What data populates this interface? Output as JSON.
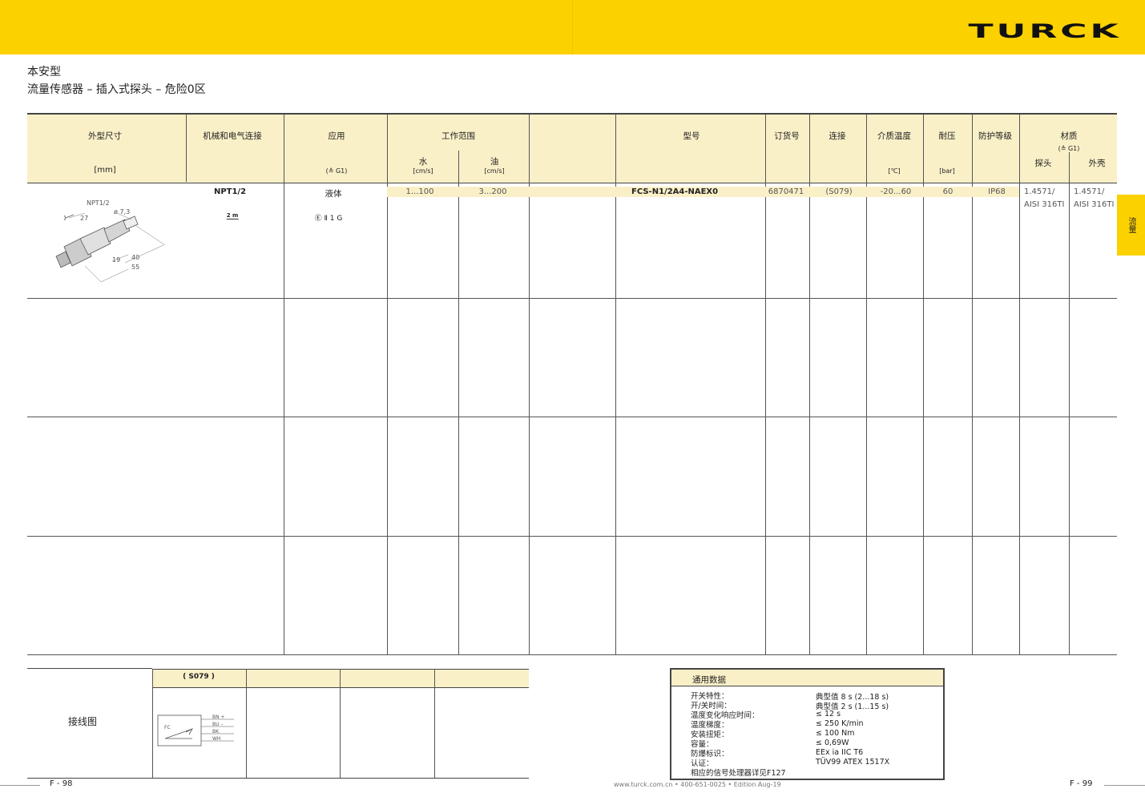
{
  "brand": {
    "logo": "TURCK"
  },
  "page": {
    "title1": "本安型",
    "title2": "流量传感器 – 插入式探头 – 危险0区"
  },
  "side_tab": {
    "label": "流量"
  },
  "table": {
    "headers": {
      "dims": "外型尺寸",
      "dims_unit": "[mm]",
      "conn": "机械和电气连接",
      "app": "应用",
      "app_note": "(≙ G1)",
      "range": "工作范围",
      "water": "水",
      "water_unit": "[cm/s]",
      "oil": "油",
      "oil_unit": "[cm/s]",
      "type": "型号",
      "order": "订货号",
      "connection": "连接",
      "temp": "介质温度",
      "temp_unit": "[℃]",
      "pressure": "耐压",
      "pressure_unit": "[bar]",
      "protection": "防护等级",
      "material": "材质",
      "material_note": "(≙ G1)",
      "probe": "探头",
      "housing": "外壳"
    },
    "row": {
      "thread": "NPT1/2",
      "cable": "2 m",
      "medium": "液体",
      "atex": "Ⅱ 1 G",
      "water": "1...100",
      "oil": "3...200",
      "type": "FCS-N1/2A4-NAEX0",
      "order": "6870471",
      "connection": "(S079)",
      "temp": "-20...60",
      "pressure": "60",
      "protection": "IP68",
      "probe_mat1": "1.4571/",
      "probe_mat2": "AISI 316TI",
      "housing_mat1": "1.4571/",
      "housing_mat2": "AISI 316TI"
    },
    "drawing": {
      "npt": "NPT1/2",
      "wrench": "27",
      "dia": "ø 7,3",
      "d19": "19",
      "d40": "40",
      "d55": "55"
    }
  },
  "wiring": {
    "label": "接线图",
    "code": "( S079 )",
    "fc": "FC",
    "wires": [
      "BN  +",
      "BU  –",
      "BK",
      "WH"
    ]
  },
  "general": {
    "title": "通用数据",
    "rows": [
      {
        "k": "开关特性：",
        "v": "典型值 8 s (2...18 s)"
      },
      {
        "k": "开/关时间：",
        "v": "典型值 2 s (1...15 s)"
      },
      {
        "k": "温度变化响应时间：",
        "v": "≤ 12 s"
      },
      {
        "k": "温度梯度：",
        "v": "≤ 250 K/min"
      },
      {
        "k": "安装扭矩：",
        "v": "≤ 100 Nm"
      },
      {
        "k": "容量：",
        "v": "≤ 0,69W"
      },
      {
        "k": "防爆标识：",
        "v": "EEx ia IIC T6"
      },
      {
        "k": "认证：",
        "v": "TÜV99 ATEX 1517X"
      },
      {
        "k": "相应的信号处理器详见F127",
        "v": ""
      }
    ]
  },
  "footer": {
    "left": "F - 98",
    "center": "www.turck.com.cn • 400-651-0025 • Edition Aug-19",
    "right": "F - 99"
  }
}
